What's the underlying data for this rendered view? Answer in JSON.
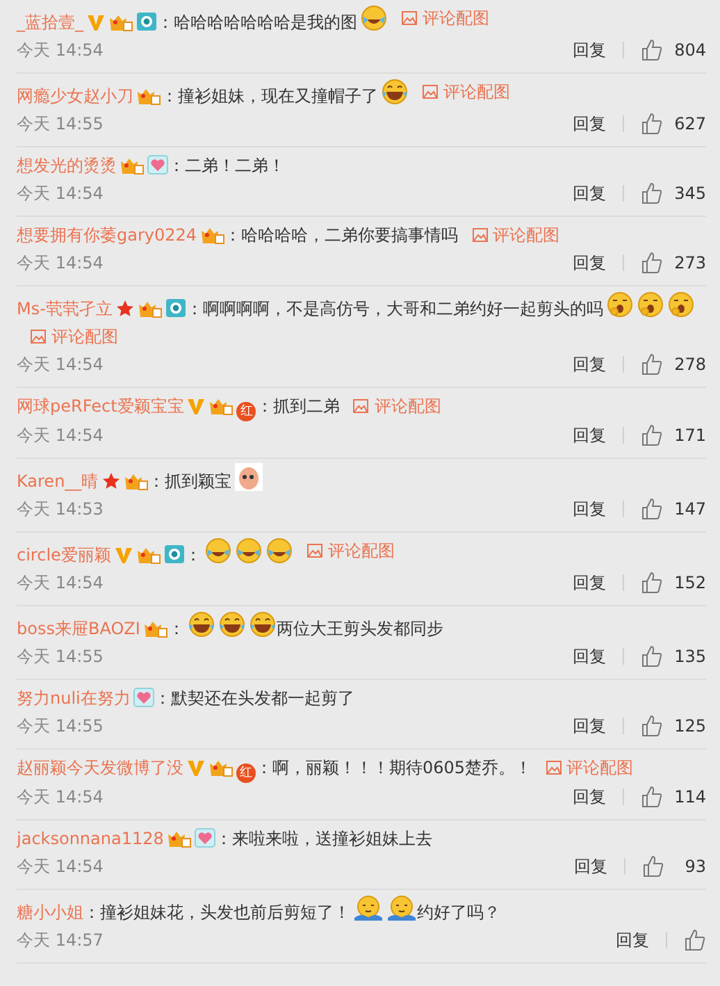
{
  "comments": [
    {
      "user": "_蓝拾壹_",
      "badges": [
        {
          "kind": "vip"
        },
        {
          "kind": "level"
        },
        {
          "kind": "camera"
        }
      ],
      "parts": [
        {
          "kind": "text",
          "text": "：哈哈哈哈哈哈哈是我的图"
        },
        {
          "kind": "tears"
        }
      ],
      "pic_link": "评论配图",
      "time": "今天 14:54",
      "reply": "回复",
      "likes": "804"
    },
    {
      "user": "网瘾少女赵小刀",
      "badges": [
        {
          "kind": "level"
        }
      ],
      "parts": [
        {
          "kind": "text",
          "text": "：撞衫姐妹，现在又撞帽子了"
        },
        {
          "kind": "grin"
        }
      ],
      "pic_link": "评论配图",
      "time": "今天 14:55",
      "reply": "回复",
      "likes": "627"
    },
    {
      "user": "想发光的烫烫",
      "badges": [
        {
          "kind": "level"
        },
        {
          "kind": "heart"
        }
      ],
      "parts": [
        {
          "kind": "text",
          "text": "：二弟！二弟！"
        }
      ],
      "time": "今天 14:54",
      "reply": "回复",
      "likes": "345"
    },
    {
      "user": "想要拥有你萎gary0224",
      "badges": [
        {
          "kind": "level"
        }
      ],
      "parts": [
        {
          "kind": "text",
          "text": "：哈哈哈哈，二弟你要搞事情吗"
        }
      ],
      "pic_link": "评论配图",
      "time": "今天 14:54",
      "reply": "回复",
      "likes": "273"
    },
    {
      "user": "Ms-茕茕孑立",
      "badges": [
        {
          "kind": "star"
        },
        {
          "kind": "level"
        },
        {
          "kind": "camera"
        }
      ],
      "parts": [
        {
          "kind": "text",
          "text": "：啊啊啊啊，不是高仿号，大哥和二弟约好一起剪头的吗"
        },
        {
          "kind": "yawn"
        },
        {
          "kind": "yawn"
        },
        {
          "kind": "yawn"
        }
      ],
      "pic_link": "评论配图",
      "time": "今天 14:54",
      "reply": "回复",
      "likes": "278"
    },
    {
      "user": "网球peRFect爱颖宝宝",
      "badges": [
        {
          "kind": "vip"
        },
        {
          "kind": "level"
        },
        {
          "kind": "honor",
          "label": "红"
        }
      ],
      "parts": [
        {
          "kind": "text",
          "text": "：抓到二弟"
        }
      ],
      "pic_link": "评论配图",
      "time": "今天 14:54",
      "reply": "回复",
      "likes": "171"
    },
    {
      "user": "Karen__晴",
      "badges": [
        {
          "kind": "star"
        },
        {
          "kind": "level"
        }
      ],
      "parts": [
        {
          "kind": "text",
          "text": "：抓到颖宝"
        },
        {
          "kind": "sticker"
        }
      ],
      "time": "今天 14:53",
      "reply": "回复",
      "likes": "147"
    },
    {
      "user": "circle爱丽颖",
      "badges": [
        {
          "kind": "vip"
        },
        {
          "kind": "level"
        },
        {
          "kind": "camera"
        }
      ],
      "parts": [
        {
          "kind": "text",
          "text": "："
        },
        {
          "kind": "tears"
        },
        {
          "kind": "tears"
        },
        {
          "kind": "tears"
        }
      ],
      "pic_link": "评论配图",
      "time": "今天 14:54",
      "reply": "回复",
      "likes": "152"
    },
    {
      "user": "boss来屉BAOZI",
      "badges": [
        {
          "kind": "level"
        }
      ],
      "parts": [
        {
          "kind": "text",
          "text": "："
        },
        {
          "kind": "grin"
        },
        {
          "kind": "grin"
        },
        {
          "kind": "grin"
        },
        {
          "kind": "text",
          "text": "两位大王剪头发都同步"
        }
      ],
      "time": "今天 14:55",
      "reply": "回复",
      "likes": "135"
    },
    {
      "user": "努力nuli在努力",
      "badges": [
        {
          "kind": "heart"
        }
      ],
      "parts": [
        {
          "kind": "text",
          "text": "：默契还在头发都一起剪了"
        }
      ],
      "time": "今天 14:55",
      "reply": "回复",
      "likes": "125"
    },
    {
      "user": "赵丽颖今天发微博了没",
      "badges": [
        {
          "kind": "vip"
        },
        {
          "kind": "level"
        },
        {
          "kind": "honor",
          "label": "红"
        }
      ],
      "parts": [
        {
          "kind": "text",
          "text": "：啊，丽颖！！！期待0605楚乔。！"
        }
      ],
      "pic_link": "评论配图",
      "time": "今天 14:54",
      "reply": "回复",
      "likes": "114"
    },
    {
      "user": "jacksonnana1128",
      "badges": [
        {
          "kind": "level"
        },
        {
          "kind": "heart"
        }
      ],
      "parts": [
        {
          "kind": "text",
          "text": "：来啦来啦，送撞衫姐妹上去"
        }
      ],
      "time": "今天 14:54",
      "reply": "回复",
      "likes": "93"
    },
    {
      "user": "糖小小姐",
      "parts": [
        {
          "kind": "text",
          "text": "：撞衫姐妹花，头发也前后剪短了！"
        },
        {
          "kind": "shy"
        },
        {
          "kind": "shy"
        },
        {
          "kind": "text",
          "text": "约好了吗？"
        }
      ],
      "time": "今天 14:57",
      "reply": "回复"
    }
  ]
}
